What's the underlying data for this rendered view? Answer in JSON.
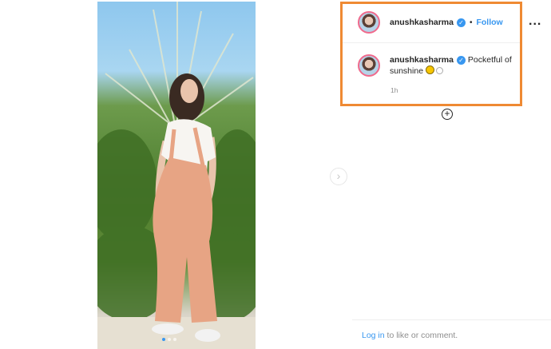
{
  "post": {
    "username": "anushkasharma",
    "follow_label": "Follow",
    "separator": "•",
    "caption_text": "Pocketful of sunshine",
    "time_ago": "1h",
    "more_label": "...",
    "next_arrow": "›",
    "add_label": "+"
  },
  "footer": {
    "login_link": "Log in",
    "login_rest": " to like or comment."
  },
  "colors": {
    "accent": "#3897f0",
    "highlight_border": "#ef8a33"
  },
  "carousel": {
    "slides": 3,
    "active_index": 0
  }
}
